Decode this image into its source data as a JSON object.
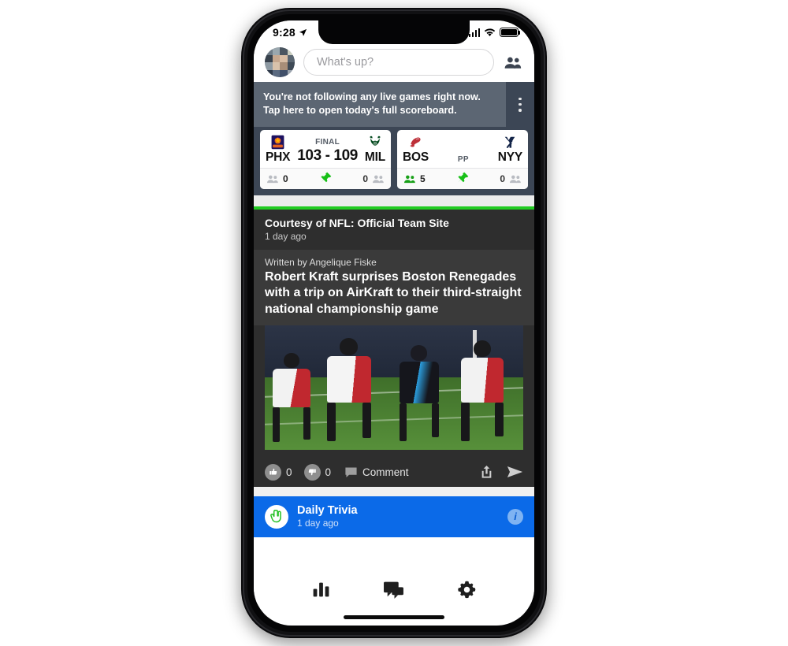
{
  "status_bar": {
    "time": "9:28",
    "location_icon": "location-arrow-icon",
    "signal_icon": "cellular-signal-icon",
    "wifi_icon": "wifi-icon",
    "battery_icon": "battery-full-icon"
  },
  "header": {
    "avatar_name": "user-avatar",
    "composer_placeholder": "What's up?",
    "people_icon": "people-group-icon"
  },
  "notice": {
    "text": "You're not following any live games right now. Tap here to open today's full scoreboard.",
    "menu_icon": "kebab-menu-icon"
  },
  "scoreboard": {
    "games": [
      {
        "away": {
          "abbr": "PHX",
          "logo": "phoenix-suns-logo",
          "followers": "0"
        },
        "home": {
          "abbr": "MIL",
          "logo": "milwaukee-bucks-logo",
          "followers": "0"
        },
        "status": "FINAL",
        "score": "103 - 109",
        "pin_icon": "pushpin-icon"
      },
      {
        "away": {
          "abbr": "BOS",
          "logo": "boston-red-sox-logo",
          "followers": "5"
        },
        "home": {
          "abbr": "NYY",
          "logo": "new-york-yankees-logo",
          "followers": "0"
        },
        "status": "PP",
        "score": "",
        "pin_icon": "pushpin-icon"
      }
    ]
  },
  "article": {
    "source": "Courtesy of NFL: Official Team Site",
    "time": "1 day ago",
    "byline": "Written by Angelique Fiske",
    "headline": "Robert Kraft surprises Boston Renegades with a trip on AirKraft to their third-straight national championship game",
    "photo_alt": "football-players-running-on-field",
    "accent_color": "#22cc22"
  },
  "actions": {
    "like_icon": "thumbs-up-icon",
    "like_count": "0",
    "dislike_icon": "thumbs-down-icon",
    "dislike_count": "0",
    "comment_icon": "comment-bubble-icon",
    "comment_label": "Comment",
    "share_icon": "share-upload-icon",
    "send_icon": "send-paperplane-icon"
  },
  "trivia": {
    "badge_icon": "pointing-hand-icon",
    "title": "Daily Trivia",
    "time": "1 day ago",
    "info_icon": "info-circle-icon",
    "background_color": "#0b6ae8"
  },
  "bottom_nav": {
    "items": [
      {
        "icon": "bar-chart-icon",
        "name": "stats"
      },
      {
        "icon": "chat-bubbles-icon",
        "name": "chat"
      },
      {
        "icon": "gear-settings-icon",
        "name": "settings"
      }
    ]
  }
}
